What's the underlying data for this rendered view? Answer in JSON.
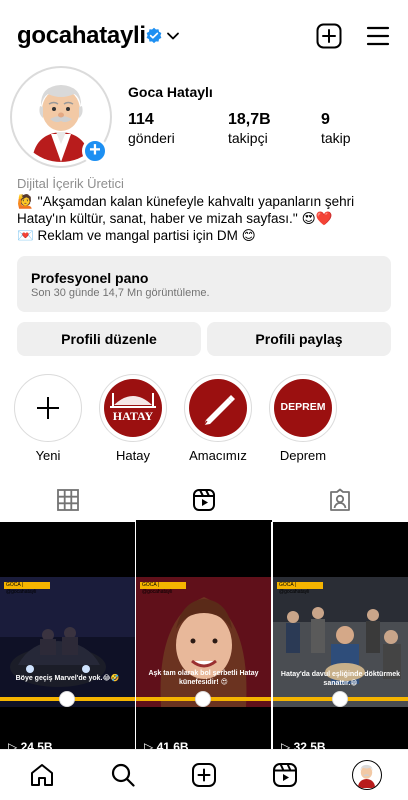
{
  "header": {
    "username": "gocahatayli",
    "icons": [
      "verified-badge-icon",
      "chevron-down-icon",
      "new-post-icon",
      "hamburger-menu-icon"
    ]
  },
  "profile": {
    "full_name": "Goca Hataylı",
    "stats": [
      {
        "value": "114",
        "label": "gönderi"
      },
      {
        "value": "18,7B",
        "label": "takipçi"
      },
      {
        "value": "9",
        "label": "takip"
      }
    ],
    "category": "Dijital İçerik Üretici",
    "bio": [
      "🙋 ''Akşamdan kalan künefeyle kahvaltı yapanların şehri",
      "Hatay'ın kültür, sanat, haber ve mizah sayfası.'' 😍❤️",
      "💌 Reklam ve mangal partisi için DM 😊"
    ],
    "add_story_symbol": "+"
  },
  "professional_panel": {
    "title": "Profesyonel pano",
    "subtitle": "Son 30 günde 14,7 Mn görüntüleme."
  },
  "actions": {
    "edit_profile": "Profili düzenle",
    "share_profile": "Profili paylaş"
  },
  "highlights": [
    {
      "label": "Yeni",
      "cover_text": ""
    },
    {
      "label": "Hatay",
      "cover_text": "HATAY"
    },
    {
      "label": "Amacımız",
      "cover_text": ""
    },
    {
      "label": "Deprem",
      "cover_text": "DEPREM"
    }
  ],
  "tabs": [
    {
      "name": "grid-tab",
      "icon": "grid-icon",
      "active": false
    },
    {
      "name": "reels-tab",
      "icon": "reels-icon",
      "active": true
    },
    {
      "name": "tagged-tab",
      "icon": "tagged-user-icon",
      "active": false
    }
  ],
  "posts": [
    {
      "caption": "Böye geçiş Marvel'de yok.😂🤣",
      "views": "24,5B",
      "tag": "GOCA | @gocahatayli"
    },
    {
      "caption": "Aşk tam olarak bol şerbetli Hatay künefesidir! 😍",
      "views": "41,6B",
      "tag": "GOCA | @gocahatayli"
    },
    {
      "caption": "Hatay'da davul eşliğinde döktürmek sanattır.😁",
      "views": "32,5B",
      "tag": "GOCA | @gocahatayli"
    }
  ],
  "bottom_nav": [
    "home-icon",
    "search-icon",
    "create-icon",
    "reels-icon",
    "profile-avatar"
  ],
  "colors": {
    "accent_blue": "#1d8ff2",
    "panel_gray": "#efefef",
    "highlight_red": "#9b1010",
    "brand_yellow": "#f5b400"
  }
}
